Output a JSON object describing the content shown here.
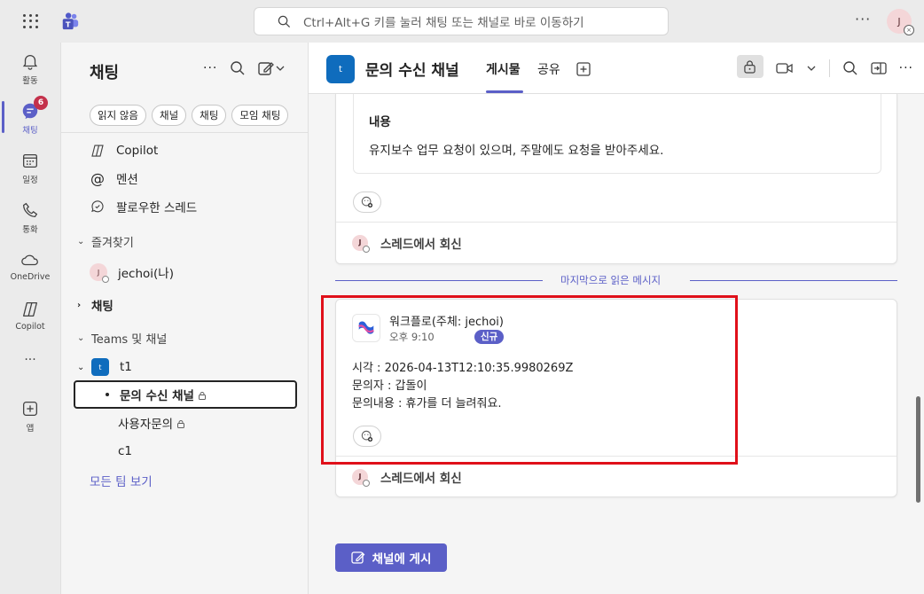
{
  "top": {
    "search_placeholder": "Ctrl+Alt+G 키를 눌러 채팅 또는 채널로 바로 이동하기",
    "more": "···",
    "avatar": "J"
  },
  "rail": {
    "activity": "활동",
    "chat": "채팅",
    "chat_badge": "6",
    "calendar": "일정",
    "calls": "통화",
    "onedrive": "OneDrive",
    "copilot": "Copilot",
    "more": "···",
    "apps": "앱"
  },
  "panel": {
    "title": "채팅",
    "filters": [
      "읽지 않음",
      "채널",
      "채팅",
      "모임 채팅"
    ],
    "copilot": "Copilot",
    "mentions": "멘션",
    "followed": "팔로우한 스레드",
    "favorites": "즐겨찾기",
    "me": "jechoi(나)",
    "chats": "채팅",
    "teams": "Teams 및 채널",
    "team": "t1",
    "team_letter": "t",
    "channels": [
      "문의 수신 채널",
      "사용자문의",
      "c1"
    ],
    "all_teams": "모든 팀 보기"
  },
  "header": {
    "letter": "t",
    "title": "문의 수신 채널",
    "tab_posts": "게시물",
    "tab_shared": "공유"
  },
  "msg1": {
    "label": "내용",
    "value": "유지보수 업무 요청이 있으며, 주말에도 요청을 받아주세요.",
    "reply": "스레드에서 회신",
    "av": "J"
  },
  "divider": "마지막으로 읽은 메시지",
  "msg2": {
    "author": "워크플로(주체: jechoi)",
    "time": "오후 9:10",
    "badge": "신규",
    "line1": "시각 : 2026-04-13T12:10:35.9980269Z",
    "line2": "문의자 : 갑돌이",
    "line3": "문의내용 : 휴가를 더 늘려줘요.",
    "reply": "스레드에서 회신",
    "av": "J"
  },
  "post_button": "채널에 게시",
  "colors": {
    "accent": "#5b5fc7",
    "highlight": "#e0101a",
    "team": "#0f6cbd"
  }
}
